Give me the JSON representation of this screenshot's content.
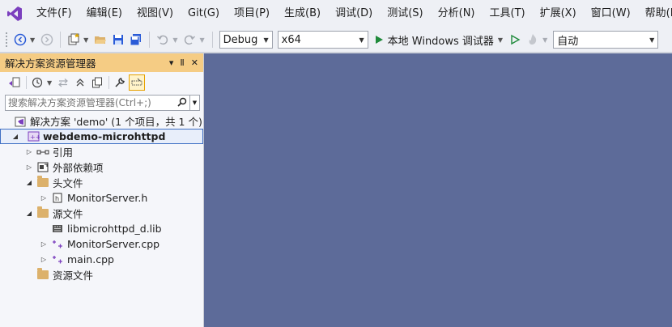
{
  "menubar": {
    "items": [
      "文件(F)",
      "编辑(E)",
      "视图(V)",
      "Git(G)",
      "项目(P)",
      "生成(B)",
      "调试(D)",
      "测试(S)",
      "分析(N)",
      "工具(T)",
      "扩展(X)",
      "窗口(W)",
      "帮助(H)"
    ]
  },
  "toolbar": {
    "configuration": "Debug",
    "platform": "x64",
    "run_label": "本地 Windows 调试器",
    "target": "自动"
  },
  "solution_explorer": {
    "title": "解决方案资源管理器",
    "title_controls": [
      "▾",
      "Ⅱ",
      "✕"
    ],
    "search_placeholder": "搜索解决方案资源管理器(Ctrl+;)",
    "tree": {
      "solution": "解决方案 'demo' (1 个项目，共 1 个)",
      "project": "webdemo-microhttpd",
      "references": "引用",
      "external_deps": "外部依赖项",
      "header_files": "头文件",
      "monitor_server_h": "MonitorServer.h",
      "source_files": "源文件",
      "lib_file": "libmicrohttpd_d.lib",
      "monitor_server_cpp": "MonitorServer.cpp",
      "main_cpp": "main.cpp",
      "resource_files": "资源文件"
    }
  },
  "colors": {
    "accent_purple": "#7b3fbe",
    "editor_background": "#5d6b99",
    "panel_title": "#f5cc84",
    "run_green": "#1f8a3b",
    "selection_border": "#3f6fc4"
  }
}
